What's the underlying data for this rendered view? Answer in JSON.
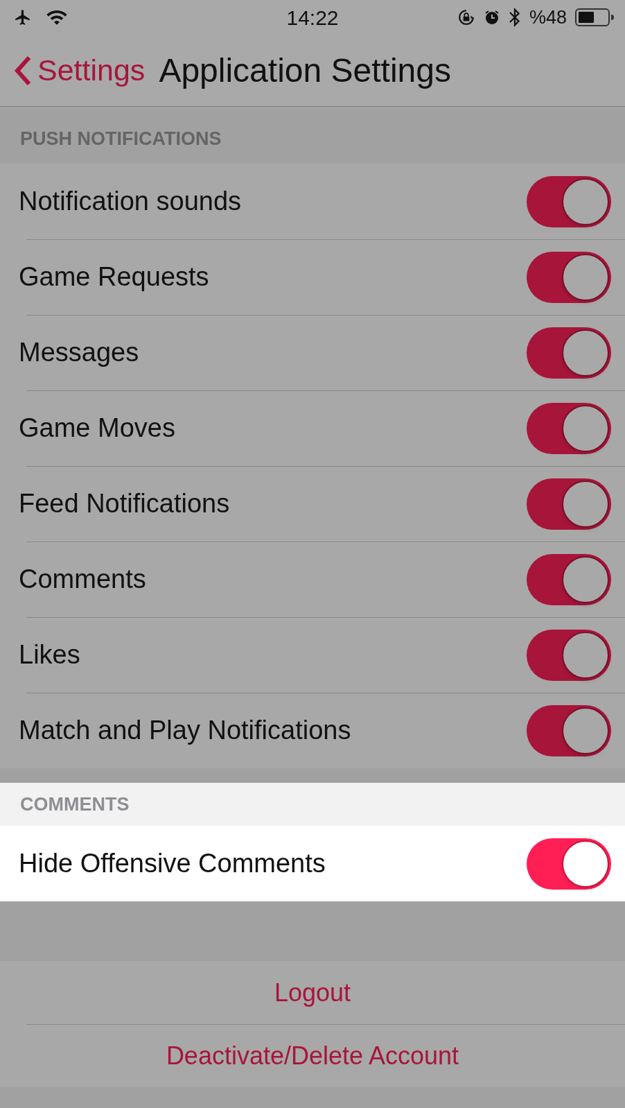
{
  "status_bar": {
    "time": "14:22",
    "battery": "%48"
  },
  "nav": {
    "back": "Settings",
    "title": "Application Settings"
  },
  "sections": [
    {
      "header": "PUSH NOTIFICATIONS",
      "highlighted": false,
      "rows": [
        {
          "label": "Notification sounds",
          "on": true
        },
        {
          "label": "Game Requests",
          "on": true
        },
        {
          "label": "Messages",
          "on": true
        },
        {
          "label": "Game Moves",
          "on": true
        },
        {
          "label": "Feed Notifications",
          "on": true
        },
        {
          "label": "Comments",
          "on": true
        },
        {
          "label": "Likes",
          "on": true
        },
        {
          "label": "Match and Play Notifications",
          "on": true
        }
      ]
    },
    {
      "header": "COMMENTS",
      "highlighted": true,
      "rows": [
        {
          "label": "Hide Offensive Comments",
          "on": true
        }
      ]
    }
  ],
  "actions": [
    {
      "label": "Logout"
    },
    {
      "label": "Deactivate/Delete Account"
    }
  ]
}
